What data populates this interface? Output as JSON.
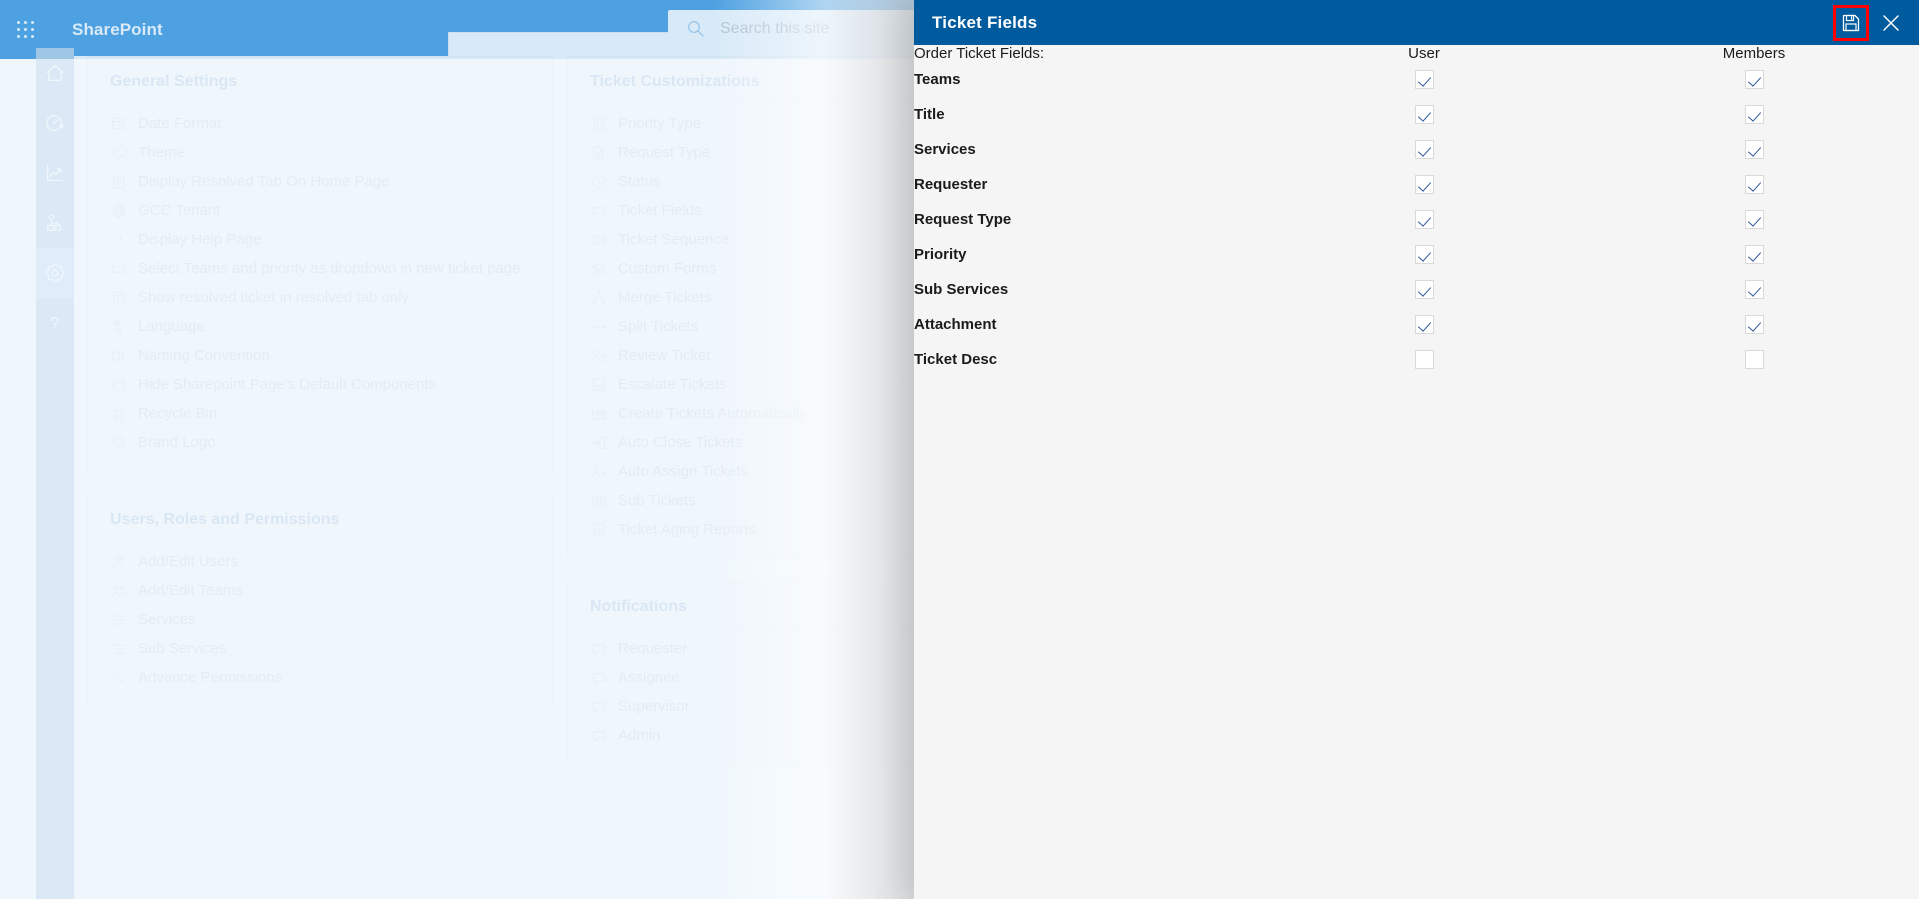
{
  "suitebar": {
    "waffle_label": "app-launcher",
    "brand": "SharePoint",
    "search": {
      "placeholder": "Search this site",
      "value": "",
      "icon": "search-icon"
    },
    "brand_color": "#0078d4"
  },
  "rail": {
    "items": [
      {
        "name": "home",
        "icon": "home-icon",
        "active": false
      },
      {
        "name": "dashboard",
        "icon": "speedometer-icon",
        "active": false
      },
      {
        "name": "reports",
        "icon": "line-chart-icon",
        "active": false
      },
      {
        "name": "teams",
        "icon": "people-team-icon",
        "active": false
      },
      {
        "name": "settings",
        "icon": "gear-icon",
        "active": true
      },
      {
        "name": "help",
        "icon": "question-mark-icon",
        "active": false
      }
    ]
  },
  "settings_page": {
    "sections": [
      {
        "title": "General Settings",
        "items": [
          {
            "label": "Date Format",
            "icon": "calendar-clock-icon"
          },
          {
            "label": "Theme",
            "icon": "palette-icon"
          },
          {
            "label": "Display Resolved Tab On Home Page",
            "icon": "document-icon"
          },
          {
            "label": "GCC Tenant",
            "icon": "globe-icon"
          },
          {
            "label": "Display Help Page",
            "icon": "question-mark-icon"
          },
          {
            "label": "Select Teams and priority as dropdown in new ticket page",
            "icon": "dropdown-icon"
          },
          {
            "label": "Show resolved ticket in resolved tab only",
            "icon": "document-icon"
          },
          {
            "label": "Language",
            "icon": "language-icon"
          },
          {
            "label": "Naming Convention",
            "icon": "rename-icon"
          },
          {
            "label": "Hide Sharepoint Page's Default Components",
            "icon": "window-icon"
          },
          {
            "label": "Recycle Bin",
            "icon": "recycle-bin-icon"
          },
          {
            "label": "Brand Logo",
            "icon": "badge-icon"
          }
        ]
      },
      {
        "title": "Users, Roles and Permissions",
        "items": [
          {
            "label": "Add/Edit Users",
            "icon": "people-icon"
          },
          {
            "label": "Add/Edit Teams",
            "icon": "people-team-icon"
          },
          {
            "label": "Services",
            "icon": "list-icon"
          },
          {
            "label": "Sub Services",
            "icon": "sub-list-icon"
          },
          {
            "label": "Advance Permissions",
            "icon": "key-icon"
          }
        ]
      },
      {
        "title": "Ticket Customizations",
        "items": [
          {
            "label": "Priority Type",
            "icon": "checklist-icon"
          },
          {
            "label": "Request Type",
            "icon": "edit-document-icon"
          },
          {
            "label": "Status",
            "icon": "clock-icon"
          },
          {
            "label": "Ticket Fields",
            "icon": "ticket-icon"
          },
          {
            "label": "Ticket Sequence",
            "icon": "number-sequence-icon"
          },
          {
            "label": "Custom Forms",
            "icon": "layers-icon"
          },
          {
            "label": "Merge Tickets",
            "icon": "merge-icon"
          },
          {
            "label": "Split Tickets",
            "icon": "split-arrows-icon"
          },
          {
            "label": "Review Ticket",
            "icon": "person-sync-icon"
          },
          {
            "label": "Escalate Tickets",
            "icon": "trend-up-icon"
          },
          {
            "label": "Create Tickets Automatically",
            "icon": "mail-folder-icon"
          },
          {
            "label": "Auto Close Tickets",
            "icon": "sign-out-icon"
          },
          {
            "label": "Auto Assign Tickets",
            "icon": "person-arrow-icon"
          },
          {
            "label": "Sub Tickets",
            "icon": "columns-icon"
          },
          {
            "label": "Ticket Aging Reports",
            "icon": "report-icon"
          }
        ]
      },
      {
        "title": "Notifications",
        "items": [
          {
            "label": "Requester",
            "icon": "comment-icon"
          },
          {
            "label": "Assignee",
            "icon": "comment-icon"
          },
          {
            "label": "Supervisor",
            "icon": "comment-icon"
          },
          {
            "label": "Admin",
            "icon": "comment-icon"
          }
        ]
      }
    ]
  },
  "panel": {
    "title": "Ticket Fields",
    "header_bg": "#005a9e",
    "save": {
      "label": "save-button",
      "icon": "save-floppy-icon",
      "highlight_color": "#ff0000"
    },
    "close": {
      "label": "close-button",
      "icon": "close-x-icon"
    },
    "columns": {
      "order_label": "Order Ticket Fields:",
      "user_label": "User",
      "members_label": "Members"
    },
    "rows": [
      {
        "field": "Teams",
        "user": true,
        "members": true
      },
      {
        "field": "Title",
        "user": true,
        "members": true
      },
      {
        "field": "Services",
        "user": true,
        "members": true
      },
      {
        "field": "Requester",
        "user": true,
        "members": true
      },
      {
        "field": "Request Type",
        "user": true,
        "members": true
      },
      {
        "field": "Priority",
        "user": true,
        "members": true
      },
      {
        "field": "Sub Services",
        "user": true,
        "members": true
      },
      {
        "field": "Attachment",
        "user": true,
        "members": true
      },
      {
        "field": "Ticket Desc",
        "user": false,
        "members": false
      }
    ]
  }
}
